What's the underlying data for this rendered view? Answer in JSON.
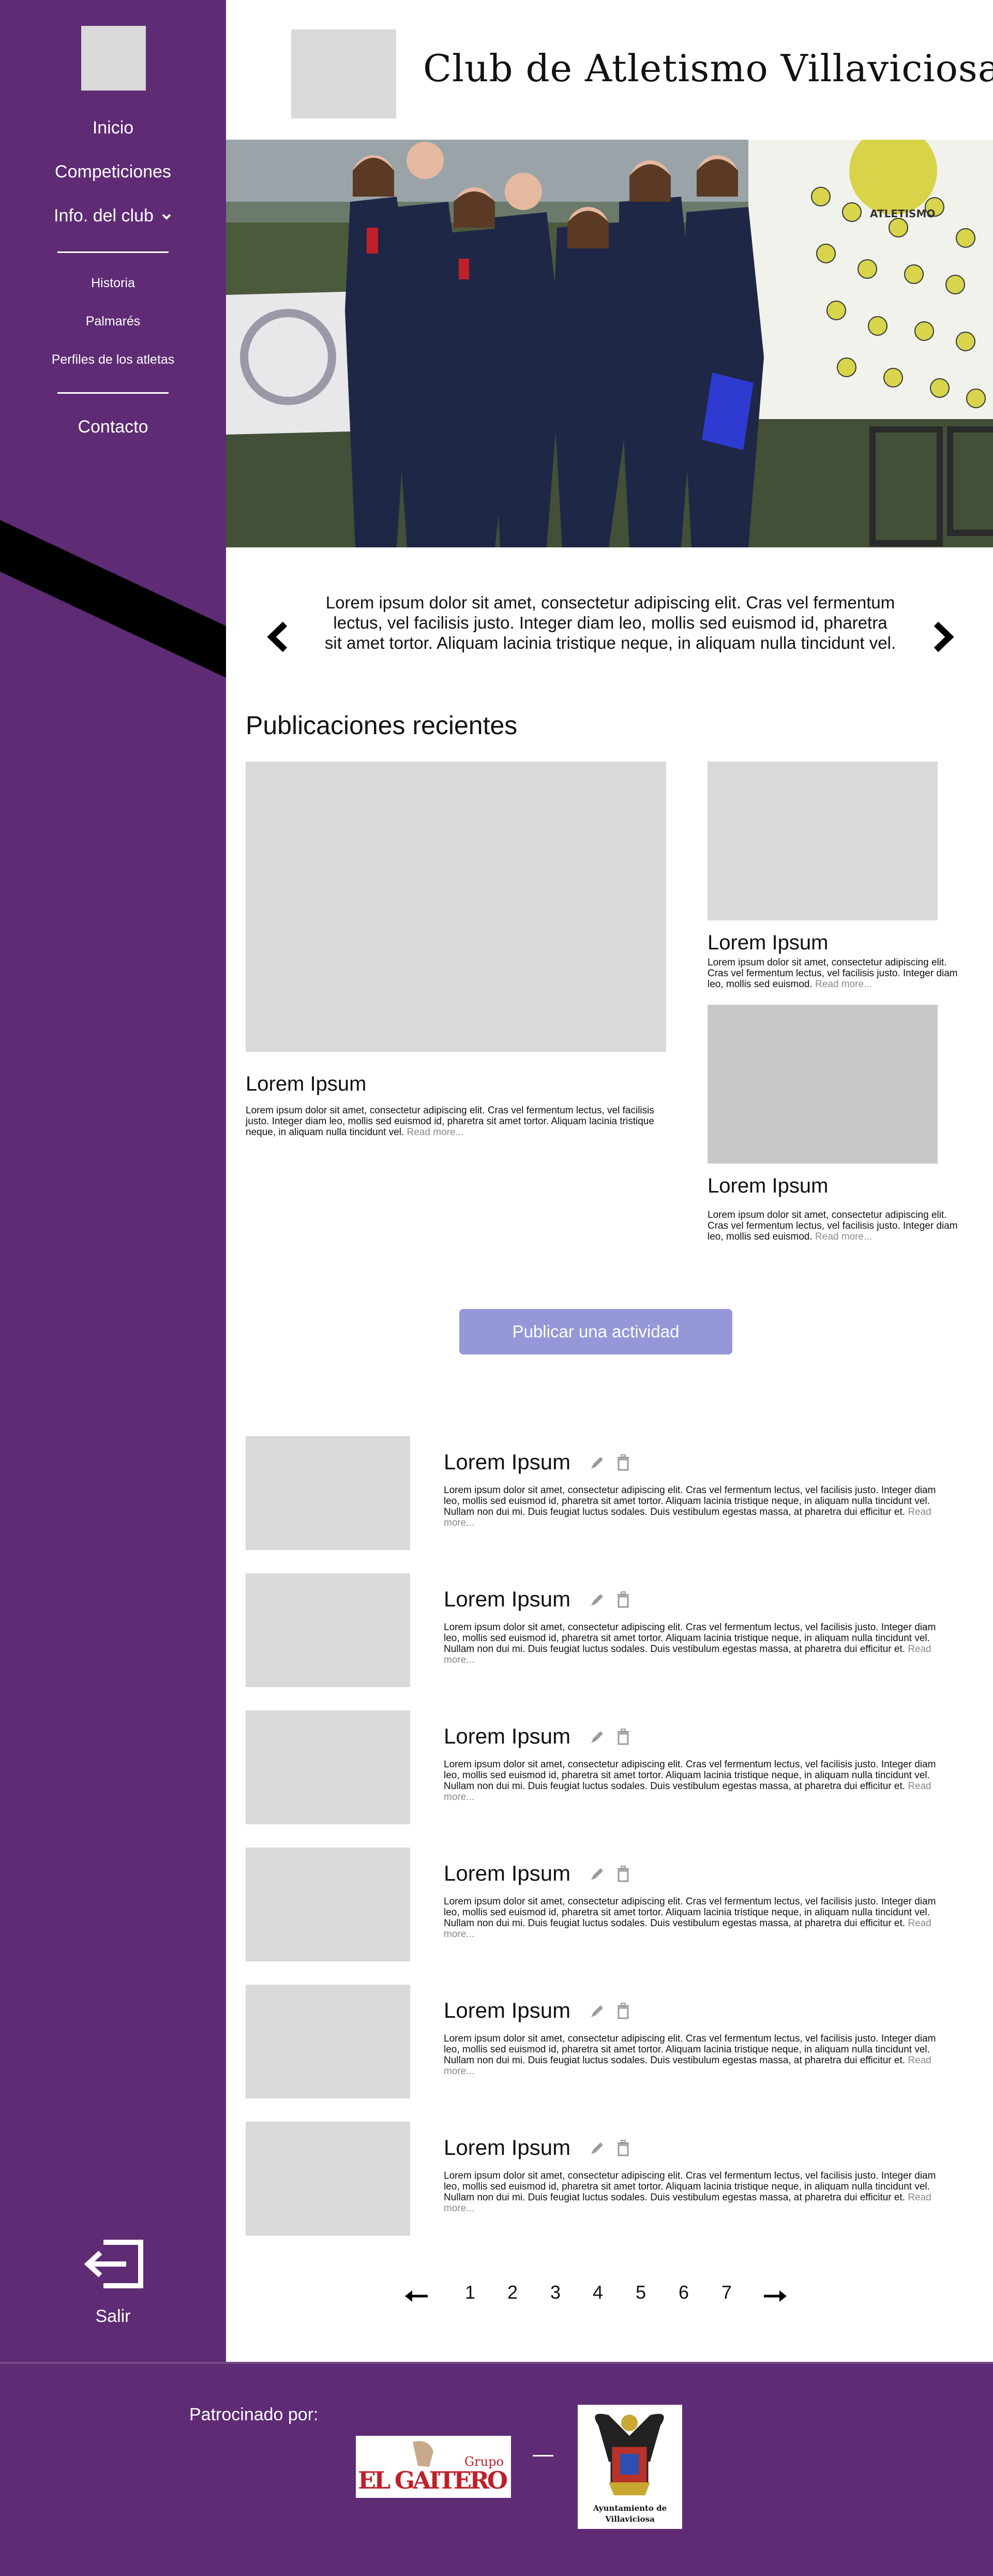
{
  "sidebar": {
    "nav": {
      "inicio": "Inicio",
      "competiciones": "Competiciones",
      "info_club": "Info. del club",
      "historia": "Historia",
      "palmares": "Palmarés",
      "perfiles": "Perfiles de los atletas",
      "contacto": "Contacto"
    },
    "logout_label": "Salir",
    "logout_icon": "logout-icon"
  },
  "header": {
    "title": "Club de Atletismo Villaviciosa"
  },
  "hero": {
    "banner_text": "ATLETISMO"
  },
  "carousel": {
    "text": "Lorem ipsum dolor sit amet, consectetur adipiscing elit. Cras vel fermentum lectus, vel facilisis justo. Integer diam leo, mollis sed euismod id, pharetra sit amet tortor. Aliquam lacinia tristique neque, in aliquam nulla tincidunt vel.",
    "prev_icon": "chevron-left-icon",
    "next_icon": "chevron-right-icon"
  },
  "recent": {
    "title": "Publicaciones recientes",
    "featured": {
      "title": "Lorem Ipsum",
      "text": "Lorem ipsum dolor sit amet, consectetur adipiscing elit. Cras vel fermentum lectus, vel facilisis justo. Integer diam leo, mollis sed euismod id, pharetra sit amet tortor. Aliquam lacinia tristique neque, in aliquam nulla tincidunt vel.",
      "read_more": "Read more..."
    },
    "side": [
      {
        "title": "Lorem Ipsum",
        "text": "Lorem ipsum dolor sit amet, consectetur adipiscing elit. Cras vel fermentum lectus, vel facilisis justo. Integer diam leo, mollis sed euismod.",
        "read_more": "Read more..."
      },
      {
        "title": "Lorem Ipsum",
        "text": "Lorem ipsum dolor sit amet, consectetur adipiscing elit. Cras vel fermentum lectus, vel facilisis justo. Integer diam leo, mollis sed euismod.",
        "read_more": "Read more..."
      }
    ]
  },
  "publish_button": "Publicar una actividad",
  "activities": [
    {
      "title": "Lorem Ipsum",
      "text": "Lorem ipsum dolor sit amet, consectetur adipiscing elit. Cras vel fermentum lectus, vel facilisis justo. Integer diam leo, mollis sed euismod id, pharetra sit amet tortor. Aliquam lacinia tristique neque, in aliquam nulla tincidunt vel. Nullam non dui mi. Duis feugiat luctus sodales. Duis vestibulum egestas massa, at pharetra dui efficitur et.",
      "read_more": "Read more..."
    },
    {
      "title": "Lorem Ipsum",
      "text": "Lorem ipsum dolor sit amet, consectetur adipiscing elit. Cras vel fermentum lectus, vel facilisis justo. Integer diam leo, mollis sed euismod id, pharetra sit amet tortor. Aliquam lacinia tristique neque, in aliquam nulla tincidunt vel. Nullam non dui mi. Duis feugiat luctus sodales. Duis vestibulum egestas massa, at pharetra dui efficitur et.",
      "read_more": "Read more..."
    },
    {
      "title": "Lorem Ipsum",
      "text": "Lorem ipsum dolor sit amet, consectetur adipiscing elit. Cras vel fermentum lectus, vel facilisis justo. Integer diam leo, mollis sed euismod id, pharetra sit amet tortor. Aliquam lacinia tristique neque, in aliquam nulla tincidunt vel. Nullam non dui mi. Duis feugiat luctus sodales. Duis vestibulum egestas massa, at pharetra dui efficitur et.",
      "read_more": "Read more..."
    },
    {
      "title": "Lorem Ipsum",
      "text": "Lorem ipsum dolor sit amet, consectetur adipiscing elit. Cras vel fermentum lectus, vel facilisis justo. Integer diam leo, mollis sed euismod id, pharetra sit amet tortor. Aliquam lacinia tristique neque, in aliquam nulla tincidunt vel. Nullam non dui mi. Duis feugiat luctus sodales. Duis vestibulum egestas massa, at pharetra dui efficitur et.",
      "read_more": "Read more..."
    },
    {
      "title": "Lorem Ipsum",
      "text": "Lorem ipsum dolor sit amet, consectetur adipiscing elit. Cras vel fermentum lectus, vel facilisis justo. Integer diam leo, mollis sed euismod id, pharetra sit amet tortor. Aliquam lacinia tristique neque, in aliquam nulla tincidunt vel. Nullam non dui mi. Duis feugiat luctus sodales. Duis vestibulum egestas massa, at pharetra dui efficitur et.",
      "read_more": "Read more..."
    },
    {
      "title": "Lorem Ipsum",
      "text": "Lorem ipsum dolor sit amet, consectetur adipiscing elit. Cras vel fermentum lectus, vel facilisis justo. Integer diam leo, mollis sed euismod id, pharetra sit amet tortor. Aliquam lacinia tristique neque, in aliquam nulla tincidunt vel. Nullam non dui mi. Duis feugiat luctus sodales. Duis vestibulum egestas massa, at pharetra dui efficitur et.",
      "read_more": "Read more..."
    }
  ],
  "pagination": {
    "pages": [
      "1",
      "2",
      "3",
      "4",
      "5",
      "6",
      "7"
    ],
    "prev_icon": "arrow-left-icon",
    "next_icon": "arrow-right-icon"
  },
  "footer": {
    "sponsor_label": "Patrocinado por:",
    "sponsor1_small": "Grupo",
    "sponsor1_name": "EL GAITERO",
    "sponsor2_line1": "Ayuntamiento de",
    "sponsor2_line2": "Villaviciosa"
  },
  "colors": {
    "primary_purple": "#5e2b74",
    "publish_button": "#9597d9",
    "placeholder": "#d9d9d9",
    "read_more": "#8a8a8a"
  }
}
